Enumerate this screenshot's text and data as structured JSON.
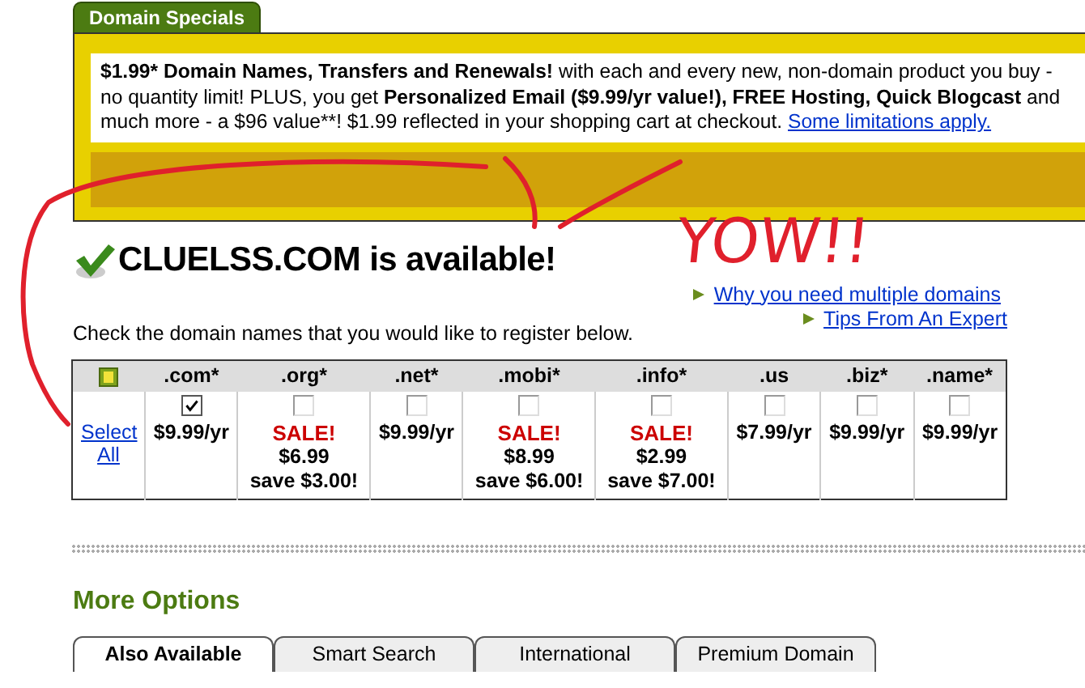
{
  "specials": {
    "tab": "Domain Specials",
    "text": "**$1.99* Domain Names, Transfers and Renewals!** with each and every new, non-domain product you buy - no quantity limit! PLUS, you get **Personalized Email ($9.99/yr value!), FREE Hosting, Quick Blogcast** and much more - a $96 value**! $1.99 reflected in your shopping cart at checkout.",
    "link": "Some limitations apply."
  },
  "availability": {
    "domain": "CLUELSS.COM is available!",
    "available": true
  },
  "annotation": {
    "text": "YOW!!"
  },
  "links": [
    "Why you need multiple domains",
    "Tips From An Expert"
  ],
  "instruction": "Check the domain names that you would like to register below.",
  "table": {
    "select_all": "Select All",
    "columns": [
      {
        "tld": ".com*",
        "checked": true,
        "kind": "regular",
        "price": "$9.99/yr"
      },
      {
        "tld": ".org*",
        "checked": false,
        "kind": "sale",
        "sale": "SALE!",
        "price": "$6.99",
        "save": "save $3.00!"
      },
      {
        "tld": ".net*",
        "checked": false,
        "kind": "regular",
        "price": "$9.99/yr"
      },
      {
        "tld": ".mobi*",
        "checked": false,
        "kind": "sale",
        "sale": "SALE!",
        "price": "$8.99",
        "save": "save $6.00!"
      },
      {
        "tld": ".info*",
        "checked": false,
        "kind": "sale",
        "sale": "SALE!",
        "price": "$2.99",
        "save": "save $7.00!"
      },
      {
        "tld": ".us",
        "checked": false,
        "kind": "regular",
        "price": "$7.99/yr"
      },
      {
        "tld": ".biz*",
        "checked": false,
        "kind": "regular",
        "price": "$9.99/yr"
      },
      {
        "tld": ".name*",
        "checked": false,
        "kind": "regular",
        "price": "$9.99/yr"
      }
    ]
  },
  "more_options": {
    "title": "More Options",
    "tabs": [
      {
        "label": "Also Available",
        "selected": true
      },
      {
        "label": "Smart Search",
        "selected": false
      },
      {
        "label": "International",
        "selected": false
      },
      {
        "label": "Premium Domain",
        "selected": false
      }
    ]
  }
}
